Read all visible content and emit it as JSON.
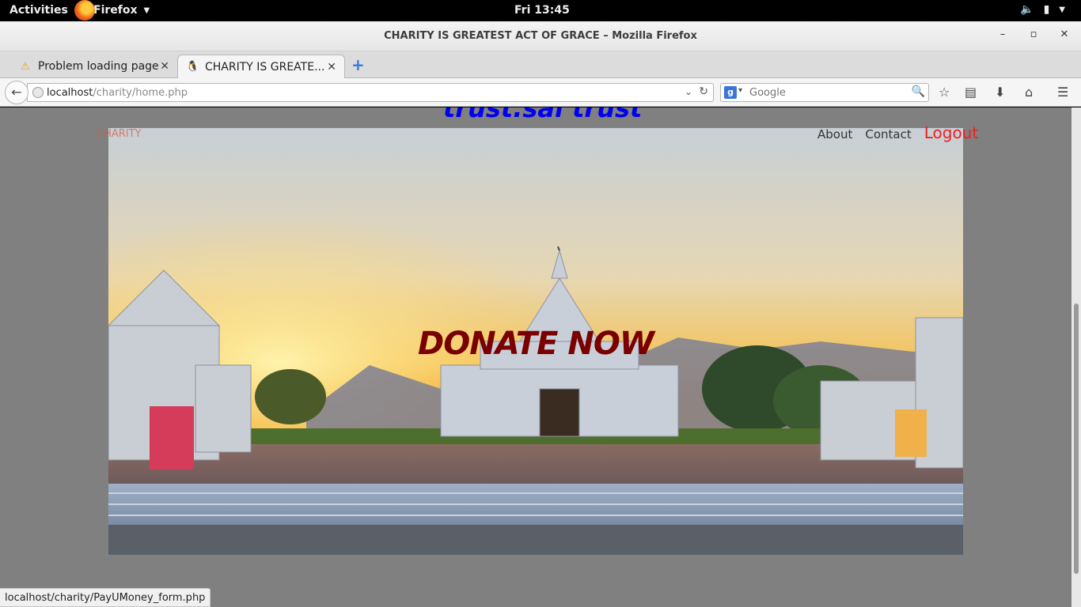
{
  "system": {
    "activities": "Activities",
    "app_name": "Firefox",
    "clock": "Fri 13:45"
  },
  "window": {
    "title": "CHARITY IS GREATEST ACT OF GRACE – Mozilla Firefox"
  },
  "tabs": [
    {
      "label": "Problem loading page",
      "icon": "warning-icon",
      "active": false
    },
    {
      "label": "CHARITY IS GREATE...",
      "icon": "tux-icon",
      "active": true
    }
  ],
  "navbar": {
    "url_host": "localhost",
    "url_path": "/charity/home.php",
    "search_placeholder": "Google"
  },
  "page": {
    "site_title": "trust.sai trust",
    "brand": "CHARITY",
    "nav": {
      "about": "About",
      "contact": "Contact",
      "logout": "Logout"
    },
    "hero_cta": "DONATE NOW"
  },
  "status": {
    "link": "localhost/charity/PayUMoney_form.php"
  },
  "colors": {
    "page_bg": "#808080",
    "site_title": "#0000ee",
    "logout": "#ee2020",
    "cta": "#7a0000"
  }
}
